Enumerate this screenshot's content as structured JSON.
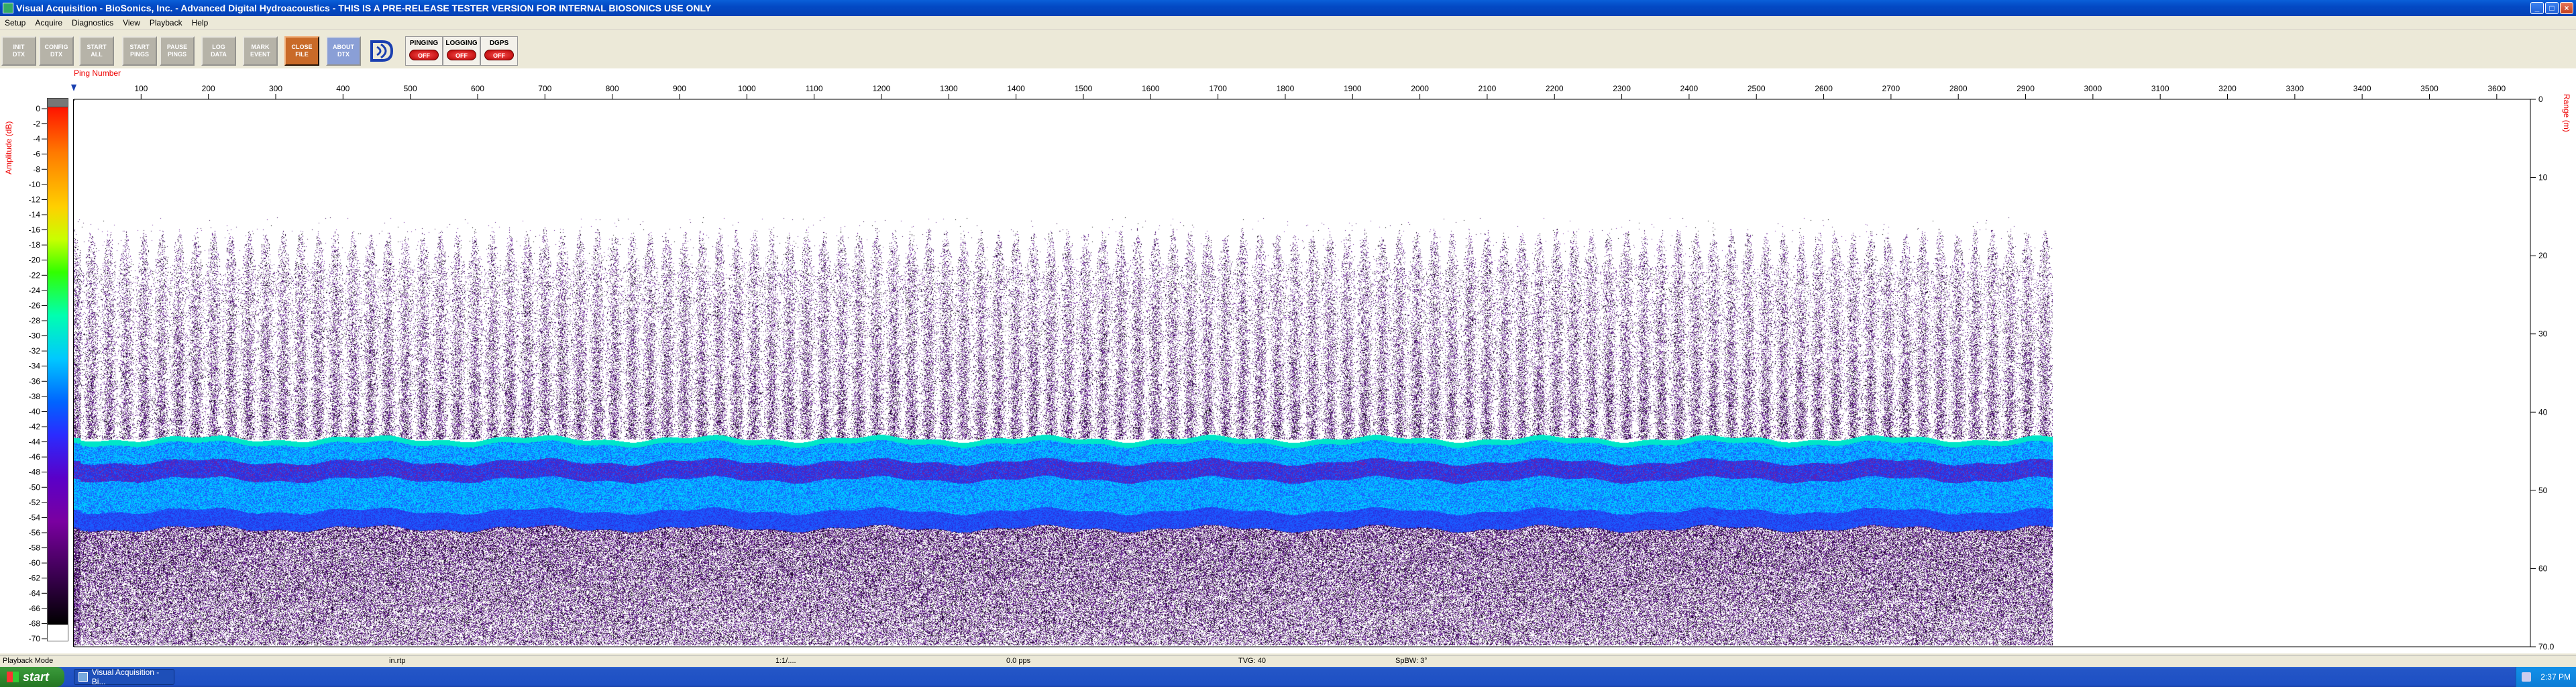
{
  "window": {
    "title": "Visual Acquisition  -  BioSonics, Inc.  -  Advanced Digital Hydroacoustics  -  THIS IS A PRE-RELEASE TESTER VERSION FOR INTERNAL BIOSONICS USE ONLY",
    "minimize": "_",
    "maximize": "□",
    "close": "×"
  },
  "menu": [
    "Setup",
    "Acquire",
    "Diagnostics",
    "View",
    "Playback",
    "Help"
  ],
  "toolbar": {
    "buttons": [
      {
        "label": "INIT\nDTX"
      },
      {
        "label": "CONFIG\nDTX"
      },
      {
        "label": "START\nALL"
      },
      {
        "label": "START\nPINGS"
      },
      {
        "label": "PAUSE\nPINGS"
      },
      {
        "label": "LOG\nDATA"
      },
      {
        "label": "MARK\nEVENT"
      },
      {
        "label": "CLOSE\nFILE"
      },
      {
        "label": "ABOUT\nDTX"
      }
    ],
    "indicators": [
      {
        "label": "PINGING",
        "state": "OFF"
      },
      {
        "label": "LOGGING",
        "state": "OFF"
      },
      {
        "label": "DGPS",
        "state": "OFF"
      }
    ]
  },
  "echogram": {
    "ping_axis_title": "Ping Number",
    "amplitude_axis_title": "Amplitude (dB)",
    "range_axis_title": "Range (m)",
    "amplitude_ticks": [
      0,
      -2,
      -4,
      -6,
      -8,
      -10,
      -12,
      -14,
      -16,
      -18,
      -20,
      -22,
      -24,
      -26,
      -28,
      -30,
      -32,
      -34,
      -36,
      -38,
      -40,
      -42,
      -44,
      -46,
      -48,
      -50,
      -52,
      -54,
      -56,
      -58,
      -60,
      -62,
      -64,
      -66,
      -68,
      -70
    ],
    "ping_ticks": [
      100,
      200,
      300,
      400,
      500,
      600,
      700,
      800,
      900,
      1000,
      1100,
      1200,
      1300,
      1400,
      1500,
      1600,
      1700,
      1800,
      1900,
      2000,
      2100,
      2200,
      2300,
      2400,
      2500,
      2600,
      2700,
      2800,
      2900,
      3000,
      3100,
      3200,
      3300,
      3400,
      3500,
      3600
    ],
    "range_ticks": [
      "0",
      "10",
      "20",
      "30",
      "40",
      "50",
      "60",
      "70.0"
    ],
    "ping_axis_range": [
      0,
      3650
    ],
    "range_axis_range": [
      0,
      70
    ],
    "amplitude_range": [
      0,
      -70
    ],
    "data_extent_pings": 2950,
    "bottom_band_range_m": [
      43.5,
      55
    ],
    "colors": {
      "scatter": "#5a1a8a",
      "band_outer": "#1a5cff",
      "band_inner": "#00c8ff",
      "band_core": "#2a30e0",
      "axis_label": "#ee0000"
    }
  },
  "status": {
    "mode": "Playback Mode",
    "field2": "in.rtp",
    "field3": "1:1/....",
    "field4": "0.0 pps",
    "field5": "TVG: 40",
    "field6": "SpBW: 3°"
  },
  "taskbar": {
    "start": "start",
    "task": "Visual Acquisition - Bi...",
    "clock": "2:37 PM"
  }
}
